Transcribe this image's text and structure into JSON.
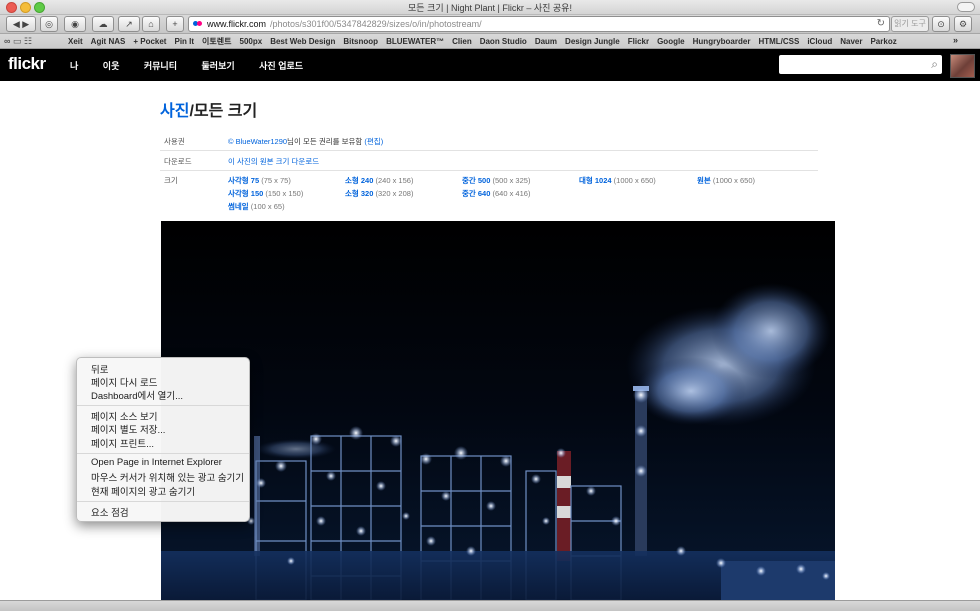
{
  "window": {
    "title": "모든 크기 | Night Plant | Flickr – 사진 공유!"
  },
  "toolbar": {
    "url_host": "www.flickr.com",
    "url_path": "/photos/s301f00/5347842829/sizes/o/in/photostream/",
    "reader_label": "읽기 도구",
    "refresh_icon": "refresh-icon"
  },
  "bookmarks": [
    "Xeit",
    "Agit NAS",
    "+ Pocket",
    "Pin It",
    "이토렌트",
    "500px",
    "Best Web Design",
    "Bitsnoop",
    "BLUEWATER™",
    "Clien",
    "Daon Studio",
    "Daum",
    "Design Jungle",
    "Flickr",
    "Google",
    "Hungryboarder",
    "HTML/CSS",
    "iCloud",
    "Naver",
    "Parkoz"
  ],
  "bookmarks_more": "»",
  "nav": {
    "logo": "flickr",
    "items": [
      "나",
      "이웃",
      "커뮤니티",
      "둘러보기",
      "사진 업로드"
    ]
  },
  "page": {
    "title_link": "사진",
    "title_rest": "/모든 크기",
    "rights_label": "사용권",
    "rights_owner": "BlueWater1290",
    "rights_text": "님이 모든 권리를 보유함",
    "rights_edit": "(편집)",
    "download_label": "다운로드",
    "download_link": "이 사진의 원본 크기 다운로드",
    "size_label": "크기",
    "sizes": [
      {
        "name": "사각형 75",
        "dim": "(75 x 75)"
      },
      {
        "name": "사각형 150",
        "dim": "(150 x 150)"
      },
      {
        "name": "썸네일",
        "dim": "(100 x 65)"
      },
      {
        "name": "소형 240",
        "dim": "(240 x 156)"
      },
      {
        "name": "소형 320",
        "dim": "(320 x 208)"
      },
      {
        "name": "중간 500",
        "dim": "(500 x 325)"
      },
      {
        "name": "중간 640",
        "dim": "(640 x 416)"
      },
      {
        "name": "대형 1024",
        "dim": "(1000 x 650)"
      },
      {
        "name": "원본",
        "dim": "(1000 x 650)"
      }
    ]
  },
  "context_menu": {
    "items": [
      "뒤로",
      "페이지 다시 로드",
      "Dashboard에서 열기...",
      "페이지 소스 보기",
      "페이지 별도 저장...",
      "페이지 프린트...",
      "Open Page in Internet Explorer",
      "마우스 커서가 위치해 있는 광고 숨기기",
      "현재 페이지의 광고 숨기기",
      "요소 점검"
    ]
  }
}
